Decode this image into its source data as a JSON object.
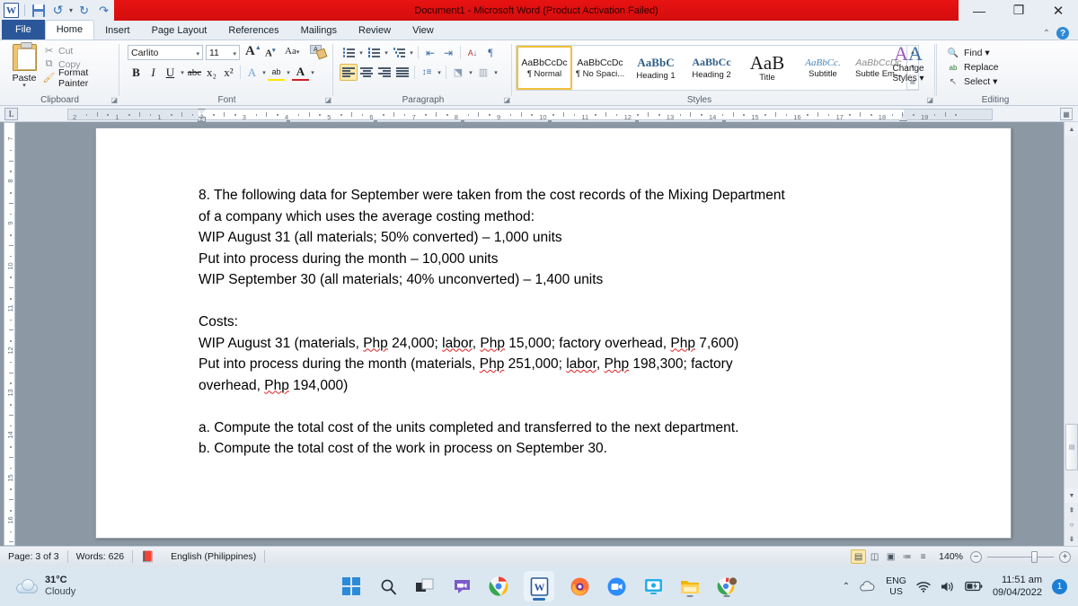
{
  "titlebar": {
    "document_title": "Document1  -  Microsoft Word (Product Activation Failed)",
    "qat": [
      {
        "name": "word-logo-icon",
        "glyph": "W"
      },
      {
        "name": "save-icon",
        "glyph": ""
      },
      {
        "name": "undo-icon",
        "glyph": "↰"
      },
      {
        "name": "redo-icon",
        "glyph": "↻"
      },
      {
        "name": "repeat-icon",
        "glyph": "↷"
      },
      {
        "name": "customize-qat-icon",
        "glyph": "▾"
      }
    ],
    "window_controls": [
      {
        "name": "minimize-button",
        "glyph": "—"
      },
      {
        "name": "restore-button",
        "glyph": "❐"
      },
      {
        "name": "close-button",
        "glyph": "✕"
      }
    ],
    "ribbon_minimize": "⌃",
    "help": "?"
  },
  "tabs": [
    {
      "label": "File",
      "active": false,
      "file": true
    },
    {
      "label": "Home",
      "active": true,
      "file": false
    },
    {
      "label": "Insert",
      "active": false,
      "file": false
    },
    {
      "label": "Page Layout",
      "active": false,
      "file": false
    },
    {
      "label": "References",
      "active": false,
      "file": false
    },
    {
      "label": "Mailings",
      "active": false,
      "file": false
    },
    {
      "label": "Review",
      "active": false,
      "file": false
    },
    {
      "label": "View",
      "active": false,
      "file": false
    }
  ],
  "ribbon": {
    "clipboard": {
      "group_label": "Clipboard",
      "paste_label": "Paste",
      "buttons": [
        {
          "label": "Cut",
          "icon": "scissors-icon",
          "glyph": "✂",
          "enabled": false
        },
        {
          "label": "Copy",
          "icon": "copy-icon",
          "glyph": "❐",
          "enabled": false
        },
        {
          "label": "Format Painter",
          "icon": "format-painter-icon",
          "glyph": "🖌",
          "enabled": true
        }
      ]
    },
    "font": {
      "group_label": "Font",
      "font_name": "Carlito",
      "font_size": "11",
      "grow_font": "A",
      "shrink_font": "A",
      "change_case": "Aa",
      "clear_formatting": "clear-formatting-icon",
      "row2": [
        {
          "name": "bold-button",
          "glyph": "B"
        },
        {
          "name": "italic-button",
          "glyph": "I"
        },
        {
          "name": "underline-button",
          "glyph": "U"
        },
        {
          "name": "strikethrough-button",
          "glyph": "abc"
        },
        {
          "name": "subscript-button",
          "glyph": "x₂"
        },
        {
          "name": "superscript-button",
          "glyph": "x²"
        },
        {
          "name": "text-effects-button",
          "glyph": "A"
        },
        {
          "name": "text-highlight-button",
          "glyph": "ab"
        },
        {
          "name": "font-color-button",
          "glyph": "A"
        }
      ]
    },
    "paragraph": {
      "group_label": "Paragraph",
      "row1": [
        {
          "name": "bullets-button"
        },
        {
          "name": "numbering-button"
        },
        {
          "name": "multilevel-list-button"
        },
        {
          "name": "decrease-indent-button"
        },
        {
          "name": "increase-indent-button"
        },
        {
          "name": "sort-button",
          "glyph": "A↓"
        },
        {
          "name": "show-formatting-marks-button",
          "glyph": "¶"
        }
      ],
      "row2": [
        {
          "name": "align-left-button",
          "selected": true
        },
        {
          "name": "align-center-button",
          "selected": false
        },
        {
          "name": "align-right-button",
          "selected": false
        },
        {
          "name": "justify-button",
          "selected": false
        },
        {
          "name": "line-spacing-button"
        },
        {
          "name": "shading-button"
        },
        {
          "name": "borders-button"
        }
      ]
    },
    "styles": {
      "group_label": "Styles",
      "items": [
        {
          "sample": "AaBbCcDc",
          "name": "¶ Normal",
          "selected": true,
          "style": "normal"
        },
        {
          "sample": "AaBbCcDc",
          "name": "¶ No Spaci...",
          "selected": false,
          "style": "normal"
        },
        {
          "sample": "AaBbC",
          "name": "Heading 1",
          "selected": false,
          "style": "h1"
        },
        {
          "sample": "AaBbCc",
          "name": "Heading 2",
          "selected": false,
          "style": "h2"
        },
        {
          "sample": "AaB",
          "name": "Title",
          "selected": false,
          "style": "title"
        },
        {
          "sample": "AaBbCc.",
          "name": "Subtitle",
          "selected": false,
          "style": "subtitle"
        },
        {
          "sample": "AaBbCcDc",
          "name": "Subtle Em...",
          "selected": false,
          "style": "subtle"
        }
      ],
      "change_styles_label_1": "Change",
      "change_styles_label_2": "Styles ▾"
    },
    "editing": {
      "group_label": "Editing",
      "buttons": [
        {
          "label": "Find ▾",
          "icon": "binoculars-icon",
          "glyph": "🔍"
        },
        {
          "label": "Replace",
          "icon": "replace-icon",
          "glyph": "ab"
        },
        {
          "label": "Select ▾",
          "icon": "select-pointer-icon",
          "glyph": "↖"
        }
      ]
    }
  },
  "ruler": {
    "tab_selector": "L",
    "horizontal_ticks": [
      "2",
      "1",
      "1",
      "2",
      "3",
      "4",
      "5",
      "6",
      "7",
      "8",
      "9",
      "10",
      "11",
      "12",
      "13",
      "14",
      "15",
      "16",
      "17",
      "18",
      "19"
    ],
    "vertical_ticks": [
      "7",
      "8",
      "9",
      "10",
      "11",
      "12",
      "13",
      "14",
      "15",
      "16"
    ]
  },
  "document": {
    "paragraphs": [
      {
        "type": "text",
        "runs": [
          {
            "t": "8. The following data for September were taken from the cost records of the Mixing Department"
          }
        ]
      },
      {
        "type": "text",
        "runs": [
          {
            "t": "of a company which uses the average costing method:"
          }
        ]
      },
      {
        "type": "text",
        "runs": [
          {
            "t": "WIP August 31 (all materials; 50% converted) – 1,000 units"
          }
        ]
      },
      {
        "type": "text",
        "runs": [
          {
            "t": "Put into process during the month – 10,000 units"
          }
        ]
      },
      {
        "type": "text",
        "runs": [
          {
            "t": "WIP September 30 (all materials; 40% unconverted) – 1,400 units"
          }
        ]
      },
      {
        "type": "blank"
      },
      {
        "type": "text",
        "runs": [
          {
            "t": "Costs:"
          }
        ]
      },
      {
        "type": "text",
        "runs": [
          {
            "t": "WIP August 31 (materials, "
          },
          {
            "t": "Php",
            "sp": true
          },
          {
            "t": " 24,000; "
          },
          {
            "t": "labor",
            "sp": true
          },
          {
            "t": ", "
          },
          {
            "t": "Php",
            "sp": true
          },
          {
            "t": " 15,000; factory overhead, "
          },
          {
            "t": "Php",
            "sp": true
          },
          {
            "t": " 7,600)"
          }
        ]
      },
      {
        "type": "text",
        "runs": [
          {
            "t": "Put into process during the month (materials, "
          },
          {
            "t": "Php",
            "sp": true
          },
          {
            "t": " 251,000; "
          },
          {
            "t": "labor",
            "sp": true
          },
          {
            "t": ", "
          },
          {
            "t": "Php",
            "sp": true
          },
          {
            "t": " 198,300; factory"
          }
        ]
      },
      {
        "type": "text",
        "runs": [
          {
            "t": "overhead, "
          },
          {
            "t": "Php",
            "sp": true
          },
          {
            "t": " 194,000)"
          }
        ]
      },
      {
        "type": "blank"
      },
      {
        "type": "text",
        "runs": [
          {
            "t": "a. Compute the total cost of the units completed and transferred to the next department."
          }
        ]
      },
      {
        "type": "text",
        "runs": [
          {
            "t": "b. Compute the total cost of the work in process on September 30."
          }
        ]
      }
    ]
  },
  "statusbar": {
    "page": "Page: 3 of 3",
    "words": "Words: 626",
    "proofing_icon": "proofing-errors-icon",
    "language": "English (Philippines)",
    "view_buttons": [
      {
        "name": "print-layout-view-button",
        "glyph": "▤",
        "selected": true
      },
      {
        "name": "full-screen-reading-view-button",
        "glyph": "◫",
        "selected": false
      },
      {
        "name": "web-layout-view-button",
        "glyph": "▣",
        "selected": false
      },
      {
        "name": "outline-view-button",
        "glyph": "≔",
        "selected": false
      },
      {
        "name": "draft-view-button",
        "glyph": "≡",
        "selected": false
      }
    ],
    "zoom_level": "140%",
    "zoom_out": "−",
    "zoom_in": "+"
  },
  "taskbar": {
    "weather": {
      "temperature": "31°C",
      "condition": "Cloudy"
    },
    "apps": [
      {
        "name": "start-button-icon",
        "glyph": ""
      },
      {
        "name": "search-icon",
        "glyph": "🔍"
      },
      {
        "name": "task-view-icon",
        "glyph": "▤"
      },
      {
        "name": "teams-chat-icon",
        "glyph": "💬"
      },
      {
        "name": "google-chrome-icon",
        "glyph": ""
      },
      {
        "name": "microsoft-word-icon",
        "glyph": "W",
        "active": true
      },
      {
        "name": "firefox-icon",
        "glyph": ""
      },
      {
        "name": "zoom-icon",
        "glyph": ""
      },
      {
        "name": "screen-app-icon",
        "glyph": ""
      },
      {
        "name": "file-explorer-icon",
        "glyph": ""
      },
      {
        "name": "chrome-profile-icon",
        "glyph": ""
      }
    ],
    "tray": {
      "show-hidden-icons": "^",
      "cloud_icon": "cloud-icon",
      "language_line1": "ENG",
      "language_line2": "US",
      "wifi_icon": "wifi-icon",
      "volume_icon": "volume-icon",
      "battery_icon": "battery-icon",
      "time": "11:51 am",
      "date": "09/04/2022",
      "notification_count": "1"
    }
  },
  "colors": {
    "title_red": "#e81313",
    "word_blue": "#2b579a",
    "taskbar": "#dbe7f0",
    "doc_bg": "#8d98a5",
    "selected_style": "#f0c13b",
    "spell_error": "#e02020"
  }
}
